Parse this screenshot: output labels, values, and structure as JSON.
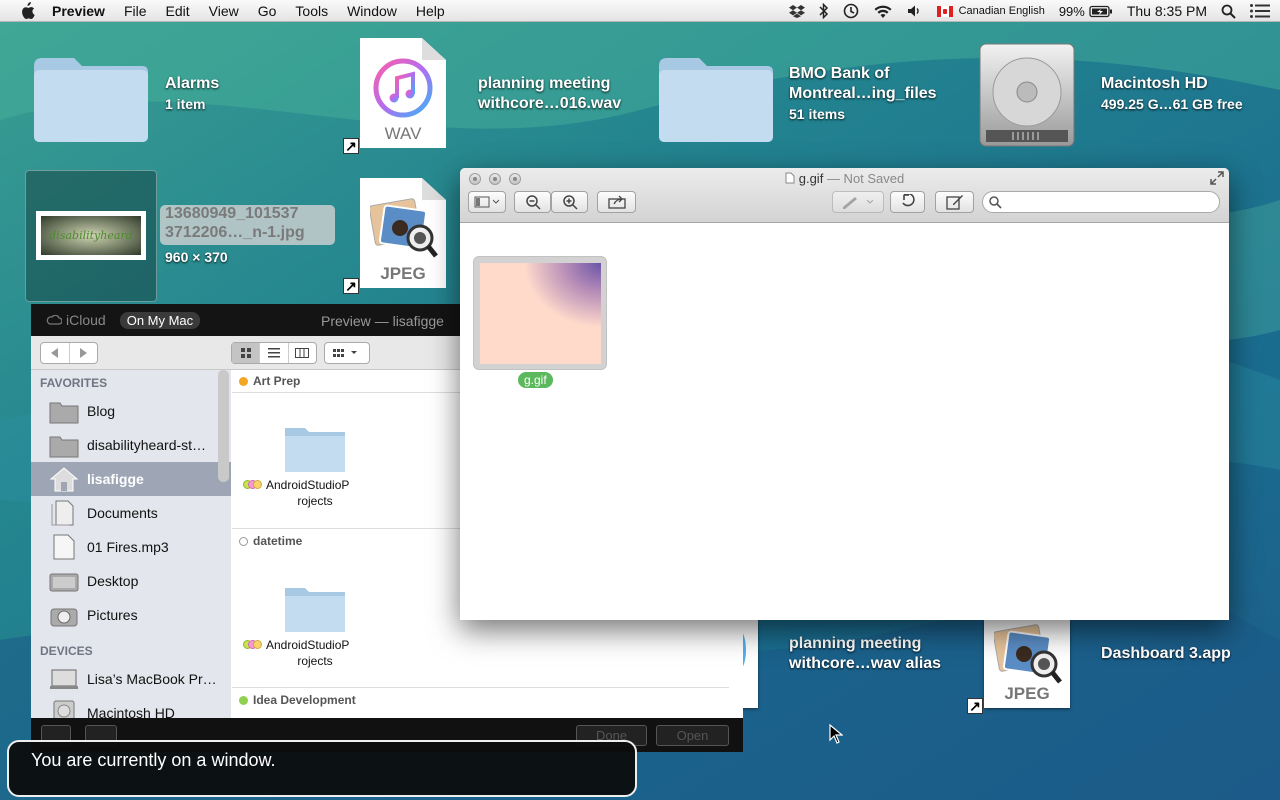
{
  "menubar": {
    "app_name": "Preview",
    "menus": [
      "File",
      "Edit",
      "View",
      "Go",
      "Tools",
      "Window",
      "Help"
    ],
    "input_source": "Canadian English",
    "battery": "99%",
    "clock": "Thu 8:35 PM",
    "icons": [
      "dropbox-icon",
      "bluetooth-icon",
      "time-machine-icon",
      "wifi-icon",
      "volume-icon",
      "flag-icon",
      "battery-icon",
      "spotlight-icon",
      "notification-center-icon"
    ]
  },
  "desktop": {
    "alarms": {
      "name": "Alarms",
      "info": "1 item"
    },
    "wav": {
      "name1": "planning meeting",
      "name2": "withcore…0​16.wav",
      "type": "WAV"
    },
    "bmo": {
      "name1": "BMO Bank of",
      "name2": "Montreal…ing_files",
      "info": "51 items"
    },
    "hd": {
      "name": "Macintosh HD",
      "info": "499.25 G…61 GB free"
    },
    "jpg": {
      "name1": "13680949_101537",
      "name2": "3712206…_n-1.jpg",
      "info": "960 × 370",
      "thumb_text": "disabilityheard"
    },
    "jpeg_top": {
      "type": "JPEG"
    },
    "alias2": {
      "name1": "planning meeting",
      "name2": "withcore…wav alias"
    },
    "jpeg_bottom": {
      "type": "JPEG"
    },
    "dashboard": {
      "name": "Dashboard 3.app"
    }
  },
  "preview": {
    "filename": "g.gif",
    "title_suffix": "— Not Saved",
    "thumb_label": "g.gif"
  },
  "filebrowser": {
    "tabs": [
      "iCloud",
      "On My Mac"
    ],
    "title": "Preview",
    "dash": "—",
    "user": "lisafigge",
    "sidebar": {
      "favorites_header": "FAVORITES",
      "favorites": [
        "Blog",
        "disabilityheard-st…",
        "lisafigge",
        "Documents",
        "01 Fires.mp3",
        "Desktop",
        "Pictures"
      ],
      "devices_header": "DEVICES",
      "devices": [
        "Lisa’s MacBook Pr…",
        "Macintosh HD"
      ]
    },
    "groups": [
      {
        "name": "Art Prep",
        "color": "#f4a623",
        "item1": "AndroidStudioP",
        "item2": "rojects"
      },
      {
        "name": "datetime",
        "color": "#ffffff",
        "item1": "AndroidStudioP",
        "item2": "rojects"
      },
      {
        "name": "Idea Development",
        "color": "#8fd14f"
      }
    ],
    "buttons": {
      "done": "Done",
      "open": "Open"
    }
  },
  "voiceover": {
    "text": "You are currently on a window."
  },
  "colors": {
    "accent_green": "#5cb85c",
    "sidebar_selected": "#9ea6b5"
  }
}
